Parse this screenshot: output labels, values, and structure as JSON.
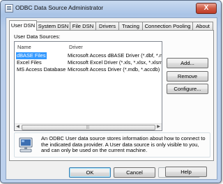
{
  "window": {
    "title": "ODBC Data Source Administrator",
    "close_label": "X"
  },
  "tabs": [
    {
      "label": "User DSN"
    },
    {
      "label": "System DSN"
    },
    {
      "label": "File DSN"
    },
    {
      "label": "Drivers"
    },
    {
      "label": "Tracing"
    },
    {
      "label": "Connection Pooling"
    },
    {
      "label": "About"
    }
  ],
  "panel": {
    "section_label": "User Data Sources:",
    "columns": {
      "name": "Name",
      "driver": "Driver"
    },
    "rows": [
      {
        "name": "dBASE Files",
        "driver": "Microsoft Access dBASE Driver (*.dbf, *.ndx",
        "selected": true
      },
      {
        "name": "Excel Files",
        "driver": "Microsoft Excel Driver (*.xls, *.xlsx, *.xlsm, *.x",
        "selected": false
      },
      {
        "name": "MS Access Database",
        "driver": "Microsoft Access Driver (*.mdb, *.accdb)",
        "selected": false
      }
    ],
    "buttons": {
      "add": "Add...",
      "remove": "Remove",
      "configure": "Configure..."
    },
    "info_text": "An ODBC User data source stores information about how to connect to the indicated data provider.   A User data source is only visible to you, and can only be used on the current machine."
  },
  "footer": {
    "ok": "OK",
    "cancel": "Cancel",
    "apply": "Apply",
    "help": "Help"
  },
  "colors": {
    "selection": "#3399ff",
    "title_gradient": "#b8cdea",
    "close_button": "#cf5b45"
  }
}
